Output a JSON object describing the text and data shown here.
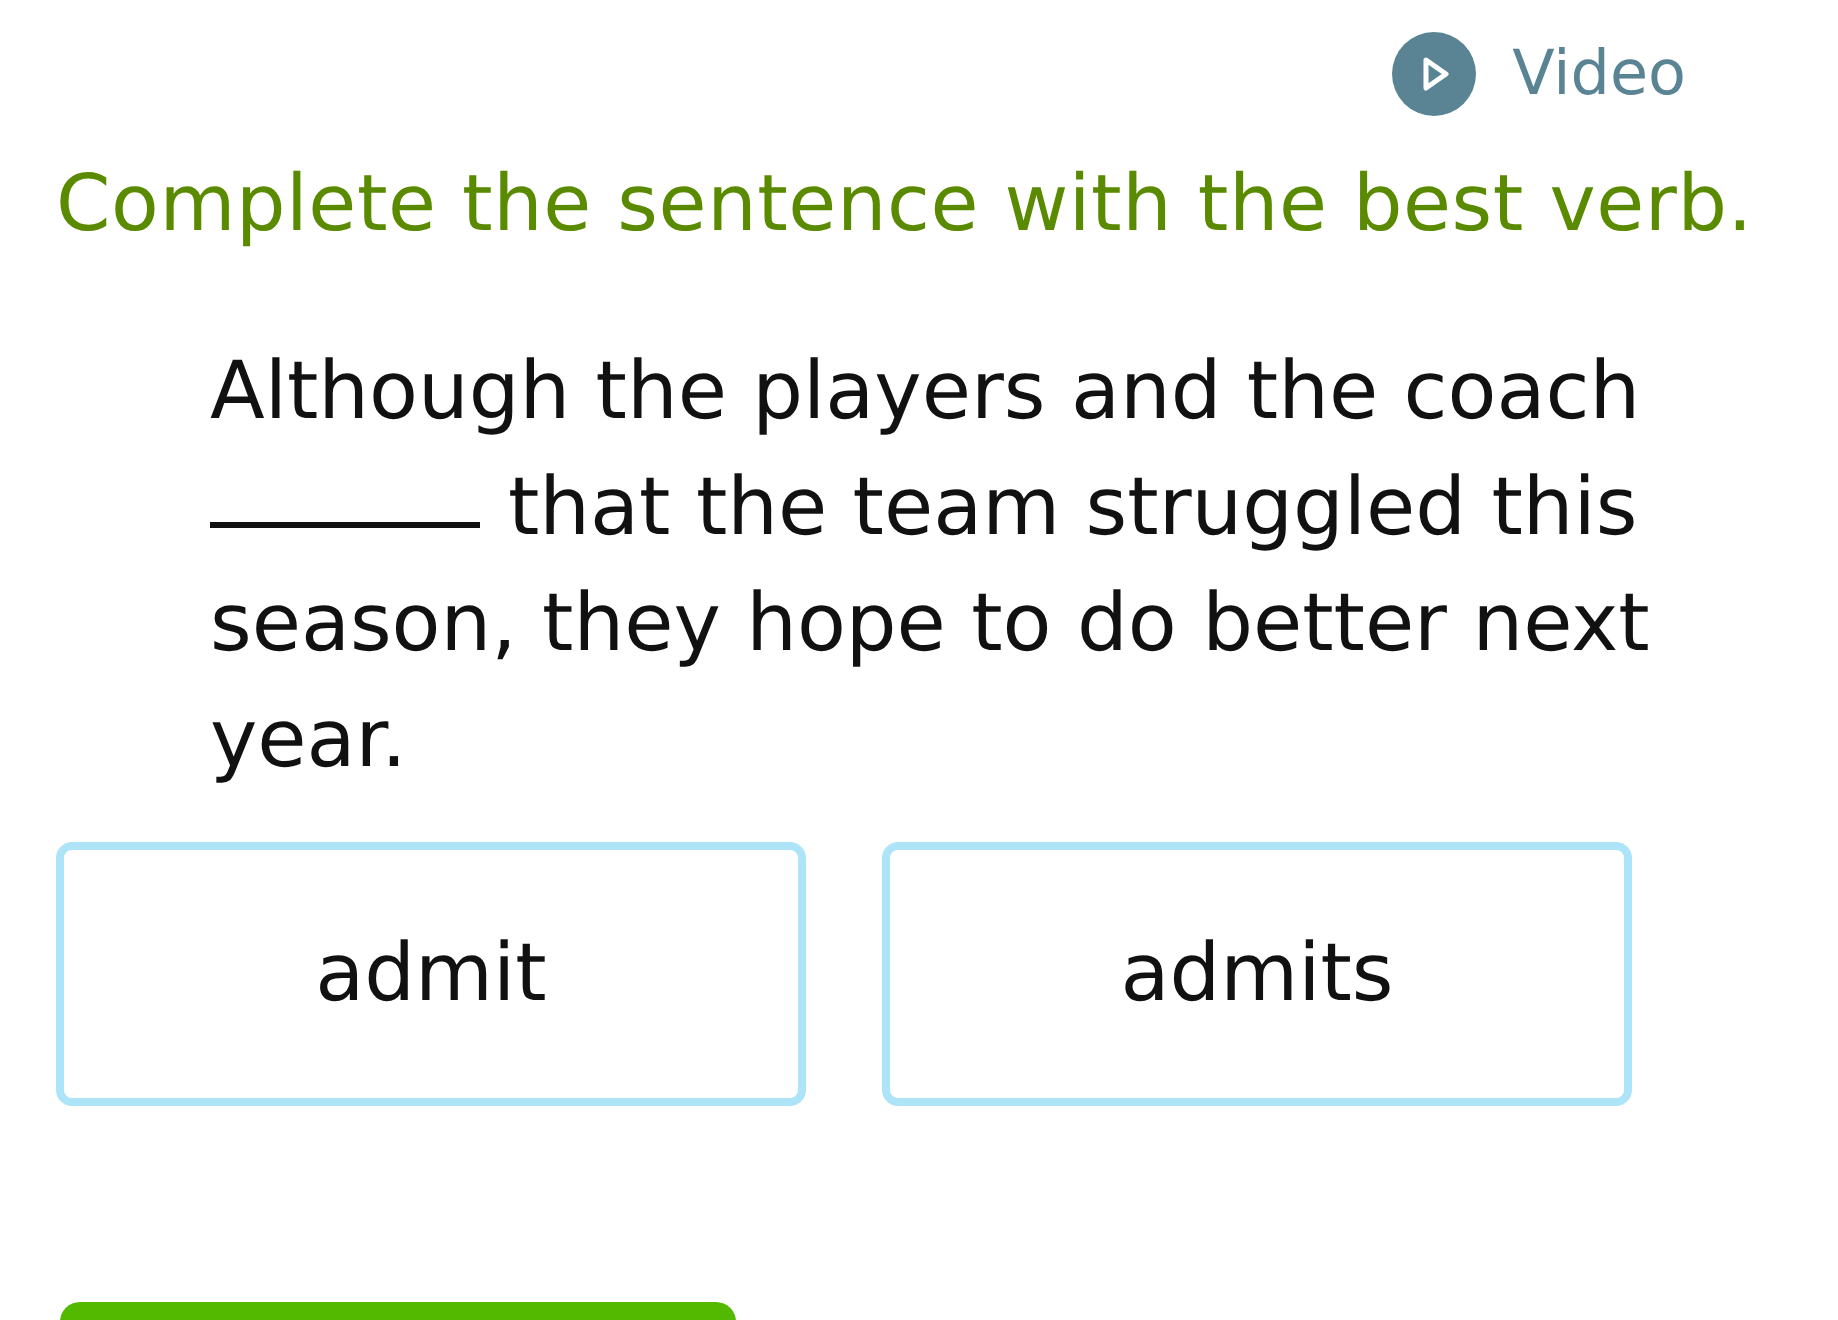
{
  "video_button": {
    "label": "Video"
  },
  "instruction": "Complete the sentence with the best verb.",
  "sentence": {
    "before": "Although the players and the coach",
    "after_blank": "that the team struggled this",
    "rest": "season, they hope to do better next year."
  },
  "choices": [
    {
      "label": "admit",
      "selected": false
    },
    {
      "label": "admits",
      "selected": false
    }
  ]
}
